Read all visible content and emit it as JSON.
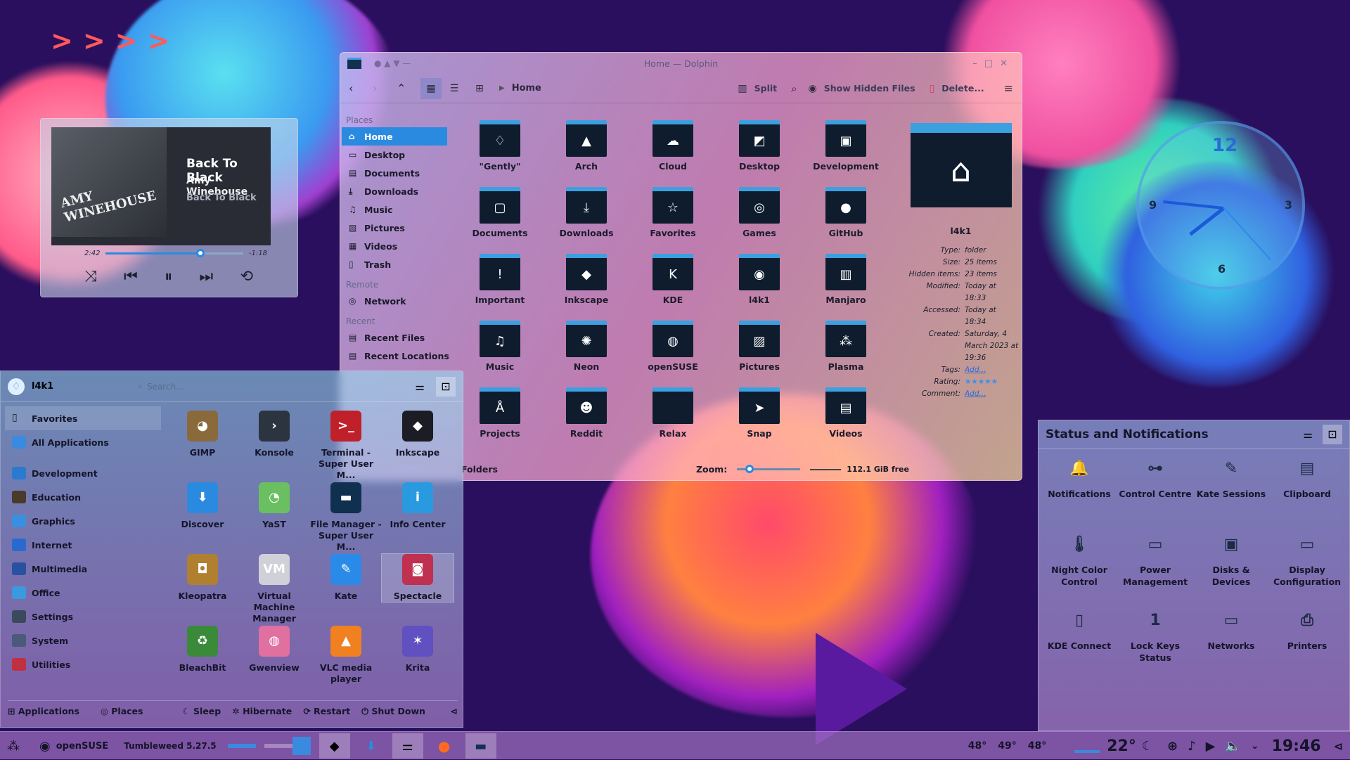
{
  "wallpaper": {
    "accent": [
      "#ff5fa0",
      "#ffb04a",
      "#4ad0f0",
      "#7a40e0",
      "#ff3050"
    ]
  },
  "player": {
    "title": "Back To Black",
    "artist": "Amy Winehouse",
    "album": "Back To Black",
    "elapsed": "2:42",
    "remaining": "-1:18",
    "progress": 0.69,
    "album_art_text": "AMY WINEHOUSE"
  },
  "dolphin": {
    "title": "Home — Dolphin",
    "breadcrumb": "Home",
    "toolbar": {
      "split": "Split",
      "show_hidden": "Show Hidden Files",
      "delete": "Delete..."
    },
    "places_header": "Places",
    "places": [
      "Home",
      "Desktop",
      "Documents",
      "Downloads",
      "Music",
      "Pictures",
      "Videos",
      "Trash"
    ],
    "remote_header": "Remote",
    "remote": [
      "Network"
    ],
    "recent_header": "Recent",
    "recent": [
      "Recent Files",
      "Recent Locations"
    ],
    "folders": [
      {
        "name": "\"Gently\"",
        "icon": "♢"
      },
      {
        "name": "Arch",
        "icon": "▲"
      },
      {
        "name": "Cloud",
        "icon": "☁"
      },
      {
        "name": "Desktop",
        "icon": "◩"
      },
      {
        "name": "Development",
        "icon": "▣"
      },
      {
        "name": "Documents",
        "icon": "▢"
      },
      {
        "name": "Downloads",
        "icon": "⤓"
      },
      {
        "name": "Favorites",
        "icon": "☆"
      },
      {
        "name": "Games",
        "icon": "◎"
      },
      {
        "name": "GitHub",
        "icon": "●"
      },
      {
        "name": "Important",
        "icon": "!"
      },
      {
        "name": "Inkscape",
        "icon": "◆"
      },
      {
        "name": "KDE",
        "icon": "K"
      },
      {
        "name": "l4k1",
        "icon": "◉"
      },
      {
        "name": "Manjaro",
        "icon": "▥"
      },
      {
        "name": "Music",
        "icon": "♫"
      },
      {
        "name": "Neon",
        "icon": "✺"
      },
      {
        "name": "openSUSE",
        "icon": "◍"
      },
      {
        "name": "Pictures",
        "icon": "▨"
      },
      {
        "name": "Plasma",
        "icon": "⁂"
      },
      {
        "name": "Projects",
        "icon": "Å"
      },
      {
        "name": "Reddit",
        "icon": "☻"
      },
      {
        "name": "Relax",
        "icon": ""
      },
      {
        "name": "Snap",
        "icon": "➤"
      },
      {
        "name": "Videos",
        "icon": "▤"
      }
    ],
    "status_left": "Folders",
    "zoom_label": "Zoom:",
    "zoom_level": 0.2,
    "free_space": "112.1 GiB free",
    "info": {
      "name": "l4k1",
      "props": [
        {
          "k": "Type:",
          "v": "folder"
        },
        {
          "k": "Size:",
          "v": "25 items"
        },
        {
          "k": "Hidden items:",
          "v": "23 items"
        },
        {
          "k": "Modified:",
          "v": "Today at 18:33"
        },
        {
          "k": "Accessed:",
          "v": "Today at 18:34"
        },
        {
          "k": "Created:",
          "v": "Saturday, 4 March 2023 at 19:36"
        },
        {
          "k": "Tags:",
          "v": "Add..."
        },
        {
          "k": "Rating:",
          "v": "★★★★★"
        },
        {
          "k": "Comment:",
          "v": "Add..."
        }
      ]
    }
  },
  "launcher": {
    "user": "l4k1",
    "search_placeholder": "Search...",
    "favorites": "Favorites",
    "all_apps": "All Applications",
    "categories": [
      {
        "name": "Development",
        "color": "#2a7ad0"
      },
      {
        "name": "Education",
        "color": "#4a3a2a"
      },
      {
        "name": "Graphics",
        "color": "#3a90e0"
      },
      {
        "name": "Internet",
        "color": "#2a6ad0"
      },
      {
        "name": "Multimedia",
        "color": "#2a50a0"
      },
      {
        "name": "Office",
        "color": "#3a9ae0"
      },
      {
        "name": "Settings",
        "color": "#3a4a5a"
      },
      {
        "name": "System",
        "color": "#4a5a7a"
      },
      {
        "name": "Utilities",
        "color": "#c03040"
      }
    ],
    "apps": [
      {
        "name": "GIMP",
        "color": "#8a6a3a",
        "glyph": "◕"
      },
      {
        "name": "Konsole",
        "color": "#2c3440",
        "glyph": "›"
      },
      {
        "name": "Terminal - Super User M...",
        "color": "#c0202a",
        "glyph": ">_"
      },
      {
        "name": "Inkscape",
        "color": "#1c1c24",
        "glyph": "◆"
      },
      {
        "name": "Discover",
        "color": "#2a8ae0",
        "glyph": "⬇"
      },
      {
        "name": "YaST",
        "color": "#6ac060",
        "glyph": "◔"
      },
      {
        "name": "File Manager - Super User M...",
        "color": "#103050",
        "glyph": "▬"
      },
      {
        "name": "Info Center",
        "color": "#2a9ae0",
        "glyph": "i"
      },
      {
        "name": "Kleopatra",
        "color": "#b08030",
        "glyph": "◘"
      },
      {
        "name": "Virtual Machine Manager",
        "color": "#d0d0d8",
        "glyph": "VM"
      },
      {
        "name": "Kate",
        "color": "#2a8ae8",
        "glyph": "✎"
      },
      {
        "name": "Spectacle",
        "color": "#c03050",
        "glyph": "◙"
      },
      {
        "name": "BleachBit",
        "color": "#3a8a3a",
        "glyph": "♻"
      },
      {
        "name": "Gwenview",
        "color": "#e070a0",
        "glyph": "◍"
      },
      {
        "name": "VLC media player",
        "color": "#f08020",
        "glyph": "▲"
      },
      {
        "name": "Krita",
        "color": "#6050c0",
        "glyph": "✶"
      }
    ],
    "footer": {
      "applications": "Applications",
      "places": "Places",
      "sleep": "Sleep",
      "hibernate": "Hibernate",
      "restart": "Restart",
      "shutdown": "Shut Down"
    }
  },
  "status": {
    "title": "Status and Notifications",
    "items": [
      {
        "name": "Notifications",
        "glyph": "🔔"
      },
      {
        "name": "Control Centre",
        "glyph": "⊶"
      },
      {
        "name": "Kate Sessions",
        "glyph": "✎"
      },
      {
        "name": "Clipboard",
        "glyph": "▤"
      },
      {
        "name": "Night Color Control",
        "glyph": "🌡"
      },
      {
        "name": "Power Management",
        "glyph": "▭"
      },
      {
        "name": "Disks & Devices",
        "glyph": "▣"
      },
      {
        "name": "Display Configuration",
        "glyph": "▭"
      },
      {
        "name": "KDE Connect",
        "glyph": "▯"
      },
      {
        "name": "Lock Keys Status",
        "glyph": "1"
      },
      {
        "name": "Networks",
        "glyph": "▭"
      },
      {
        "name": "Printers",
        "glyph": "⎙"
      }
    ]
  },
  "clock": {
    "numbers": [
      "12",
      "3",
      "6",
      "9"
    ]
  },
  "taskbar": {
    "distro": "openSUSE",
    "version": "Tumbleweed 5.27.5",
    "temps": [
      "48°",
      "49°",
      "48°"
    ],
    "weather": "22°",
    "time": "19:46"
  }
}
